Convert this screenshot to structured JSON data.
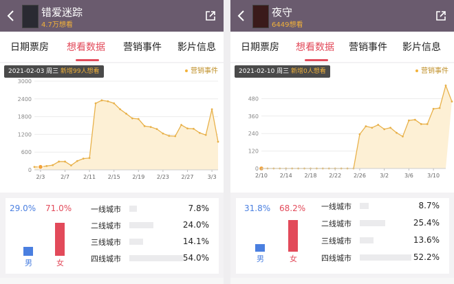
{
  "tabs": [
    "日期票房",
    "想看数据",
    "营销事件",
    "影片信息"
  ],
  "colors": {
    "header": "#6a5b6e",
    "accent": "#e24a5a",
    "gold": "#f2b23a",
    "male": "#4a7fe0",
    "female": "#e24a5a"
  },
  "panels": [
    {
      "title": "错爱迷踪",
      "sub": "4.7万想看",
      "tooltip": {
        "date": "2021-02-03 周三",
        "text": "新增99人想看"
      },
      "legend": "营销事件",
      "demo": {
        "male_pct": "29.0%",
        "female_pct": "71.0%",
        "male_label": "男",
        "female_label": "女",
        "male_value": 29.0,
        "female_value": 71.0,
        "cities": [
          {
            "name": "一线城市",
            "pct": "7.8%",
            "value": 7.8
          },
          {
            "name": "二线城市",
            "pct": "24.0%",
            "value": 24.0
          },
          {
            "name": "三线城市",
            "pct": "14.1%",
            "value": 14.1
          },
          {
            "name": "四线城市",
            "pct": "54.0%",
            "value": 54.0
          }
        ]
      }
    },
    {
      "title": "夜守",
      "sub": "6449想看",
      "tooltip": {
        "date": "2021-02-10 周三",
        "text": "新增0人想看"
      },
      "legend": "营销事件",
      "demo": {
        "male_pct": "31.8%",
        "female_pct": "68.2%",
        "male_label": "男",
        "female_label": "女",
        "male_value": 31.8,
        "female_value": 68.2,
        "cities": [
          {
            "name": "一线城市",
            "pct": "8.7%",
            "value": 8.7
          },
          {
            "name": "二线城市",
            "pct": "25.4%",
            "value": 25.4
          },
          {
            "name": "三线城市",
            "pct": "13.6%",
            "value": 13.6
          },
          {
            "name": "四线城市",
            "pct": "52.2%",
            "value": 52.2
          }
        ]
      }
    }
  ],
  "chart_data": [
    {
      "type": "area",
      "x": [
        "2/2",
        "2/3",
        "2/4",
        "2/5",
        "2/6",
        "2/7",
        "2/8",
        "2/9",
        "2/10",
        "2/11",
        "2/12",
        "2/13",
        "2/14",
        "2/15",
        "2/16",
        "2/17",
        "2/18",
        "2/19",
        "2/20",
        "2/21",
        "2/22",
        "2/23",
        "2/24",
        "2/25",
        "2/26",
        "2/27",
        "2/28",
        "3/1",
        "3/2",
        "3/3",
        "3/4"
      ],
      "values": [
        99,
        99,
        130,
        160,
        280,
        280,
        150,
        300,
        380,
        400,
        2250,
        2350,
        2320,
        2250,
        2050,
        1900,
        1740,
        1720,
        1480,
        1450,
        1380,
        1230,
        1150,
        1140,
        1520,
        1400,
        1390,
        1250,
        1180,
        2050,
        950
      ],
      "xticks": [
        "2/3",
        "2/7",
        "2/11",
        "2/15",
        "2/19",
        "2/23",
        "2/27",
        "3/3"
      ],
      "yticks": [
        "0",
        "600",
        "1200",
        "1800",
        "2400",
        "3000"
      ],
      "ylim": [
        0,
        3000
      ]
    },
    {
      "type": "area",
      "x": [
        "2/10",
        "2/11",
        "2/12",
        "2/13",
        "2/14",
        "2/15",
        "2/16",
        "2/17",
        "2/18",
        "2/19",
        "2/20",
        "2/21",
        "2/22",
        "2/23",
        "2/24",
        "2/25",
        "2/26",
        "2/27",
        "2/28",
        "3/1",
        "3/2",
        "3/3",
        "3/4",
        "3/5",
        "3/6",
        "3/7",
        "3/8",
        "3/9",
        "3/10",
        "3/11",
        "3/12"
      ],
      "values": [
        0,
        0,
        0,
        0,
        0,
        0,
        0,
        0,
        0,
        0,
        0,
        0,
        0,
        0,
        0,
        0,
        235,
        290,
        280,
        300,
        270,
        280,
        245,
        220,
        330,
        335,
        305,
        305,
        410,
        415,
        570,
        460
      ],
      "xticks": [
        "2/10",
        "2/14",
        "2/18",
        "2/22",
        "2/26",
        "3/2",
        "3/6",
        "3/10"
      ],
      "yticks": [
        "0",
        "120",
        "240",
        "360",
        "480"
      ],
      "ylim": [
        0,
        600
      ]
    }
  ]
}
